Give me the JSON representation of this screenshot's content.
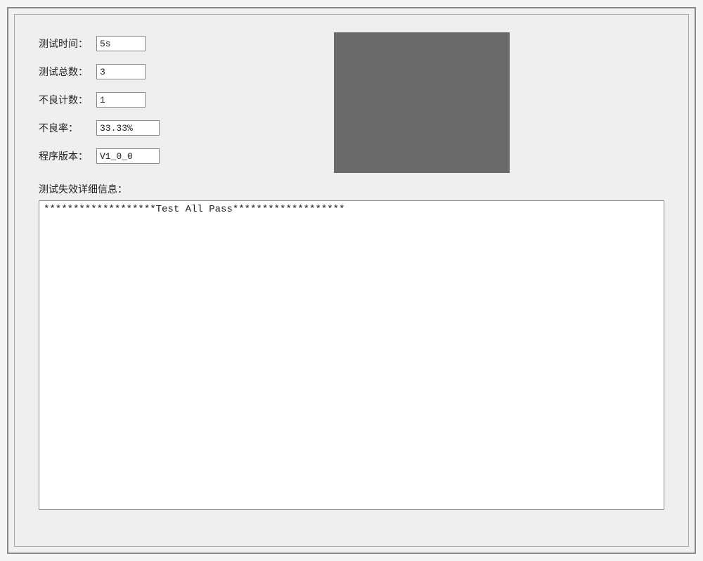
{
  "form": {
    "test_time_label": "测试时间：",
    "test_time_value": "5s",
    "test_total_label": "测试总数：",
    "test_total_value": "3",
    "fail_count_label": "不良计数：",
    "fail_count_value": "1",
    "fail_rate_label": "不良率：",
    "fail_rate_value": "33.33%",
    "version_label": "程序版本：",
    "version_value": "V1_0_0"
  },
  "detail": {
    "label": "测试失效详细信息：",
    "content": "*******************Test All Pass*******************\n"
  }
}
